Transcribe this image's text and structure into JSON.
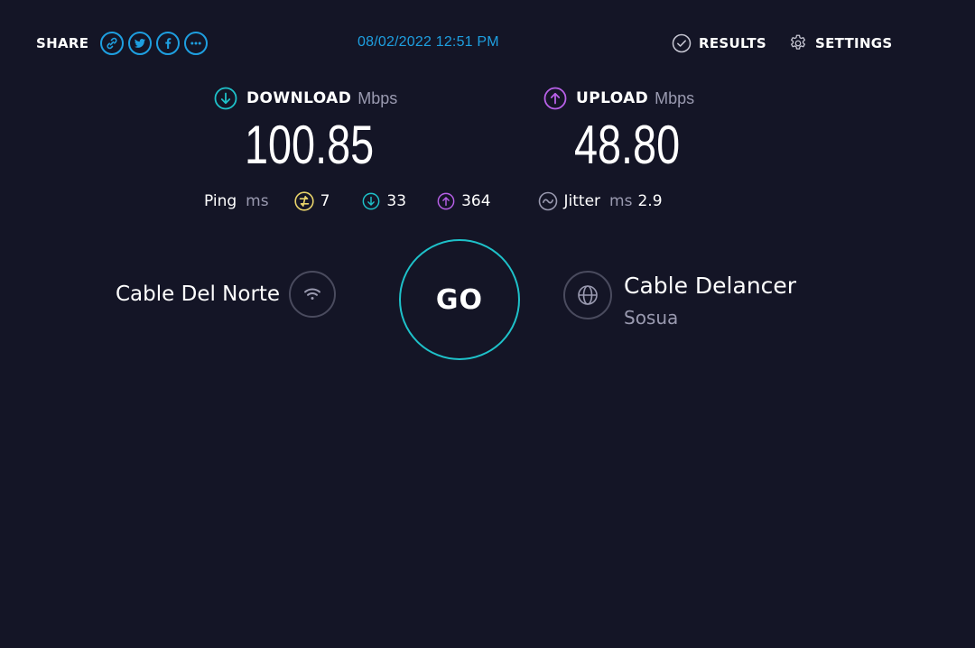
{
  "share": {
    "label": "SHARE",
    "buttons": [
      "link-icon",
      "twitter-icon",
      "facebook-icon",
      "more-icon"
    ]
  },
  "datetime": "08/02/2022 12:51 PM",
  "nav": {
    "results_label": "RESULTS",
    "settings_label": "SETTINGS"
  },
  "download": {
    "label": "DOWNLOAD",
    "unit": "Mbps",
    "value": "100.85",
    "color": "#1ec1c9"
  },
  "upload": {
    "label": "UPLOAD",
    "unit": "Mbps",
    "value": "48.80",
    "color": "#b860e8"
  },
  "ping": {
    "label": "Ping",
    "unit": "ms",
    "idle": "7",
    "download": "33",
    "upload": "364",
    "idle_color": "#e8d36a"
  },
  "jitter": {
    "label": "Jitter",
    "unit": "ms",
    "value": "2.9"
  },
  "isp": {
    "name": "Cable Del Norte"
  },
  "go": {
    "label": "GO",
    "accent": "#1ec1c9"
  },
  "server": {
    "name": "Cable Delancer",
    "location": "Sosua"
  }
}
